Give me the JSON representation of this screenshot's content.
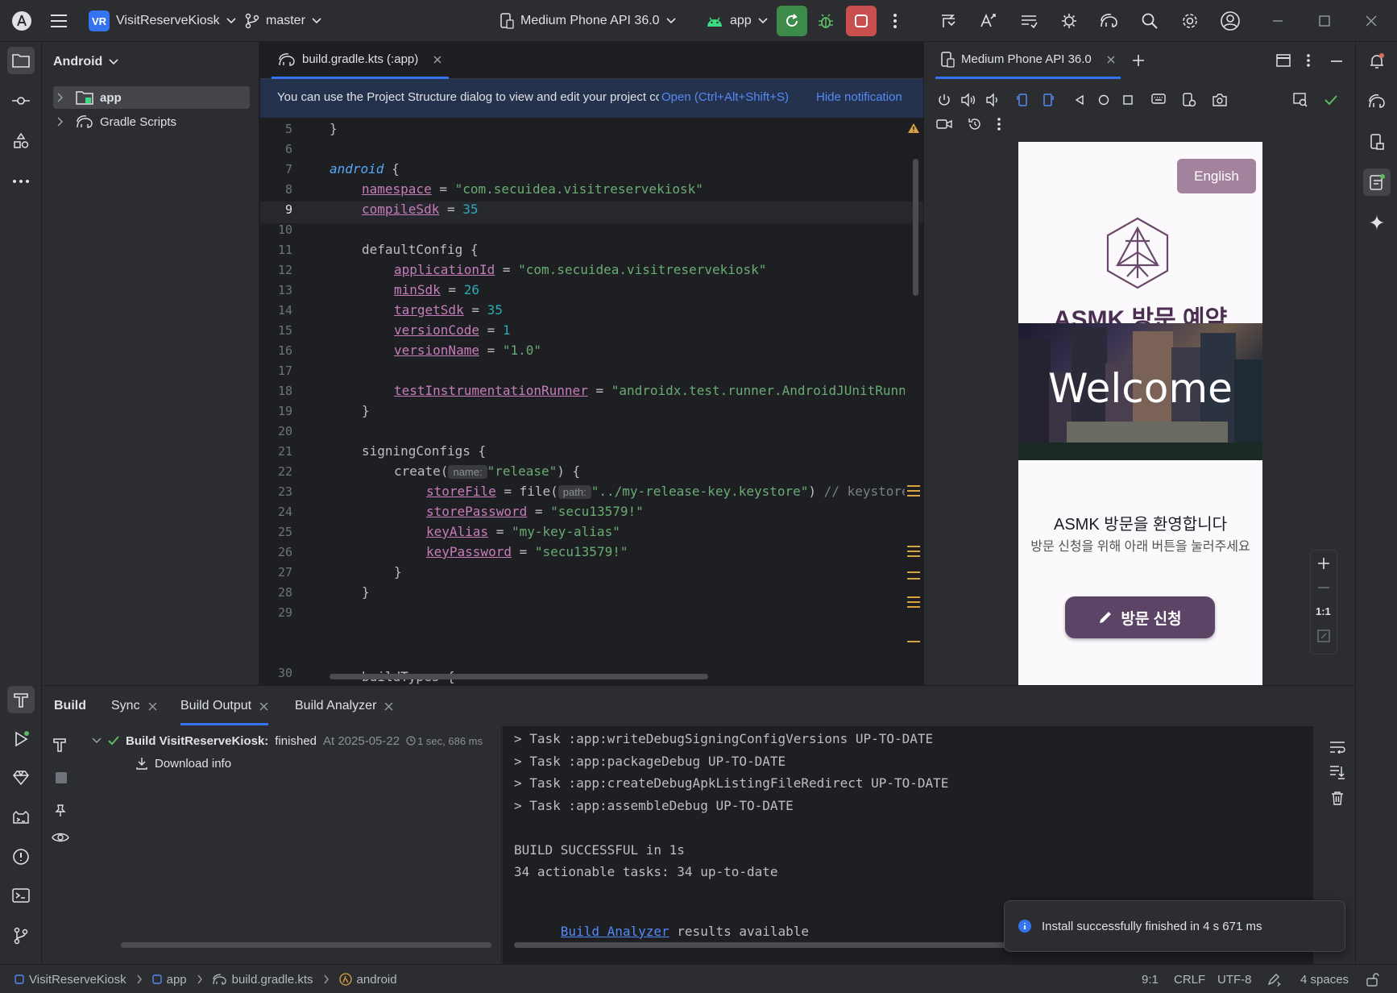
{
  "titlebar": {
    "project_badge": "VR",
    "project_name": "VisitReserveKiosk",
    "branch": "master",
    "device": "Medium Phone API 36.0",
    "run_config": "app"
  },
  "project_panel": {
    "title": "Android",
    "items": [
      {
        "label": "app"
      },
      {
        "label": "Gradle Scripts"
      }
    ]
  },
  "editor": {
    "tab_label": "build.gradle.kts (:app)",
    "notification": {
      "text": "You can use the Project Structure dialog to view and edit your project configuration",
      "open_label": "Open (Ctrl+Alt+Shift+S)",
      "hide_label": "Hide notification"
    },
    "current_line": 9,
    "line_numbers": [
      "5",
      "6",
      "7",
      "8",
      "9",
      "10",
      "11",
      "12",
      "13",
      "14",
      "15",
      "16",
      "17",
      "18",
      "19",
      "20",
      "21",
      "22",
      "23",
      "24",
      "25",
      "26",
      "27",
      "28",
      "29",
      "30"
    ],
    "code": {
      "l5": "}",
      "l7_kw": "android",
      "l7_rest": " {",
      "l8_prop": "namespace",
      "l8_eq": " = ",
      "l8_str": "\"com.secuidea.visitreservekiosk\"",
      "l9_prop": "compileSdk",
      "l9_eq": " = ",
      "l9_num": "35",
      "l11": "defaultConfig {",
      "l12_prop": "applicationId",
      "l12_eq": " = ",
      "l12_str": "\"com.secuidea.visitreservekiosk\"",
      "l13_prop": "minSdk",
      "l13_eq": " = ",
      "l13_num": "26",
      "l14_prop": "targetSdk",
      "l14_eq": " = ",
      "l14_num": "35",
      "l15_prop": "versionCode",
      "l15_eq": " = ",
      "l15_num": "1",
      "l16_prop": "versionName",
      "l16_eq": " = ",
      "l16_str": "\"1.0\"",
      "l18_prop": "testInstrumentationRunner",
      "l18_eq": " = ",
      "l18_str": "\"androidx.test.runner.AndroidJUnitRunner\"",
      "l19": "}",
      "l21": "signingConfigs {",
      "l22_a": "create(",
      "l22_hint": "name:",
      "l22_str": "\"release\"",
      "l22_b": ") {",
      "l23_prop": "storeFile",
      "l23_a": " = file(",
      "l23_hint": "path:",
      "l23_str": "\"../my-release-key.keystore\"",
      "l23_b": ") ",
      "l23_cmt": "// keystore",
      "l24_prop": "storePassword",
      "l24_eq": " = ",
      "l24_str": "\"secu13579!\"",
      "l25_prop": "keyAlias",
      "l25_eq": " = ",
      "l25_str": "\"my-key-alias\"",
      "l26_prop": "keyPassword",
      "l26_eq": " = ",
      "l26_str": "\"secu13579!\"",
      "l27": "}",
      "l28": "}",
      "l30": "buildTypes {"
    }
  },
  "devices": {
    "tab_label": "Medium Phone API 36.0",
    "zoom_label": "1:1",
    "app": {
      "language_button": "English",
      "logo_title": "ASMK 방문 예약",
      "welcome": "Welcome",
      "heading": "ASMK 방문을 환영합니다",
      "subtext": "방문 신청을 위해 아래 버튼을 눌러주세요",
      "apply_button": "방문 신청"
    }
  },
  "build": {
    "tabs": [
      {
        "label": "Build"
      },
      {
        "label": "Sync"
      },
      {
        "label": "Build Output"
      },
      {
        "label": "Build Analyzer"
      }
    ],
    "result_title": "Build VisitReserveKiosk:",
    "result_status": "finished",
    "result_time": "At 2025-05-22",
    "result_duration": "1 sec, 686 ms",
    "download_info": "Download info",
    "output_lines": [
      "> Task :app:writeDebugSigningConfigVersions UP-TO-DATE",
      "> Task :app:packageDebug UP-TO-DATE",
      "> Task :app:createDebugApkListingFileRedirect UP-TO-DATE",
      "> Task :app:assembleDebug UP-TO-DATE",
      "",
      "BUILD SUCCESSFUL in 1s",
      "34 actionable tasks: 34 up-to-date",
      ""
    ],
    "analyzer_link": "Build Analyzer",
    "analyzer_rest": " results available",
    "toast": "Install successfully finished in 4 s 671 ms"
  },
  "statusbar": {
    "breadcrumbs": [
      "VisitReserveKiosk",
      "app",
      "build.gradle.kts",
      "android"
    ],
    "position": "9:1",
    "line_sep": "CRLF",
    "encoding": "UTF-8",
    "indent": "4 spaces"
  },
  "colors": {
    "accent": "#3574f0",
    "run_green": "#3d8b49",
    "stop_red": "#c94f4f",
    "app_purple": "#5b4466",
    "english_btn": "#a3829e"
  }
}
